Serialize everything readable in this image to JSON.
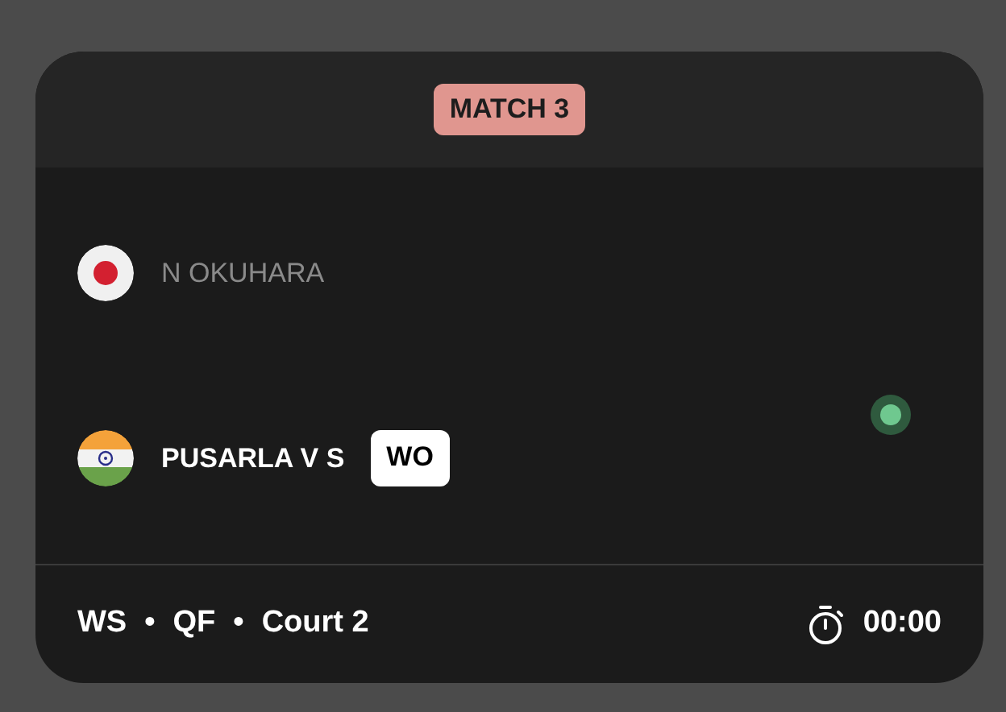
{
  "match_label": "MATCH 3",
  "players": [
    {
      "kind": "japan",
      "name": "N OKUHARA",
      "winner": false
    },
    {
      "kind": "india",
      "name": "PUSARLA V S",
      "winner": true,
      "badge": "WO"
    }
  ],
  "live": true,
  "footer": {
    "details": [
      "WS",
      "QF",
      "Court 2"
    ],
    "separator": "•",
    "timer": "00:00"
  }
}
